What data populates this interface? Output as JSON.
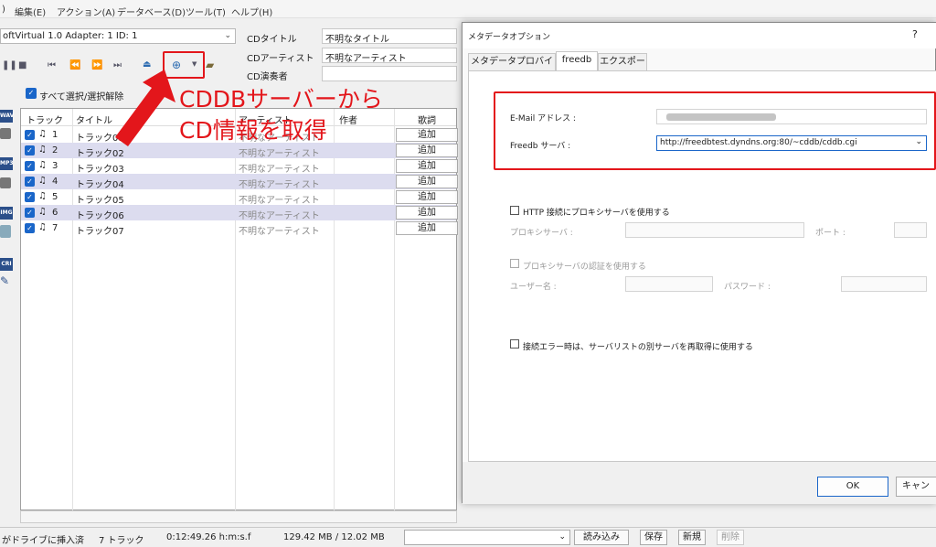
{
  "menu": {
    "items": [
      ")",
      "編集(E)",
      "アクション(A)",
      "データベース(D)",
      "ツール(T)",
      "ヘルプ(H)"
    ]
  },
  "drive": {
    "combo": "oftVirtual 1.0   Adapter: 1  ID: 1"
  },
  "cdinfo": {
    "title_label": "CDタイトル",
    "title_value": "不明なタイトル",
    "artist_label": "CDアーティスト",
    "artist_value": "不明なアーティスト",
    "performer_label": "CD演奏者",
    "performer_value": ""
  },
  "selectall_label": "すべて選択/選択解除",
  "list": {
    "headers": [
      "トラック",
      "タイトル",
      "アーティスト",
      "作者",
      "歌詞"
    ],
    "rows": [
      {
        "num": "1",
        "title": "トラック01",
        "artist": "不明なアーティスト",
        "action": "追加"
      },
      {
        "num": "2",
        "title": "トラック02",
        "artist": "不明なアーティスト",
        "action": "追加"
      },
      {
        "num": "3",
        "title": "トラック03",
        "artist": "不明なアーティスト",
        "action": "追加"
      },
      {
        "num": "4",
        "title": "トラック04",
        "artist": "不明なアーティスト",
        "action": "追加"
      },
      {
        "num": "5",
        "title": "トラック05",
        "artist": "不明なアーティスト",
        "action": "追加"
      },
      {
        "num": "6",
        "title": "トラック06",
        "artist": "不明なアーティスト",
        "action": "追加"
      },
      {
        "num": "7",
        "title": "トラック07",
        "artist": "不明なアーティスト",
        "action": "追加"
      }
    ]
  },
  "side_icons": [
    "WAV",
    "MP3",
    "IMG",
    "CRI"
  ],
  "callout": {
    "line1": "CDDBサーバーから",
    "line2": "CD情報を取得"
  },
  "status": {
    "drive": "がドライブに挿入済",
    "tracks": "7 トラック",
    "time": "0:12:49.26 h:m:s.f",
    "size": "129.42 MB /  12.02 MB",
    "buttons": {
      "load": "読み込み",
      "save": "保存",
      "new": "新規",
      "delete": "削除"
    }
  },
  "dialog": {
    "title": "メタデータオプション",
    "help": "?",
    "tabs": [
      "メタデータプロバイダ",
      "freedb",
      "エクスポート"
    ],
    "email_label": "E-Mail アドレス :",
    "server_label": "Freedb サーバ :",
    "server_value": "http://freedbtest.dyndns.org:80/~cddb/cddb.cgi",
    "http_proxy_label": "HTTP 接続にプロキシサーバを使用する",
    "proxy_server_label": "プロキシサーバ :",
    "port_label": "ポート :",
    "proxy_auth_label": "プロキシサーバの認証を使用する",
    "user_label": "ユーザー名 :",
    "password_label": "パスワード :",
    "retry_label": "接続エラー時は、サーバリストの別サーバを再取得に使用する",
    "ok": "OK",
    "cancel": "キャンセ"
  },
  "colors": {
    "accent_red": "#e3161b",
    "check_blue": "#1a66c9",
    "alt_row": "#dcdcef"
  }
}
